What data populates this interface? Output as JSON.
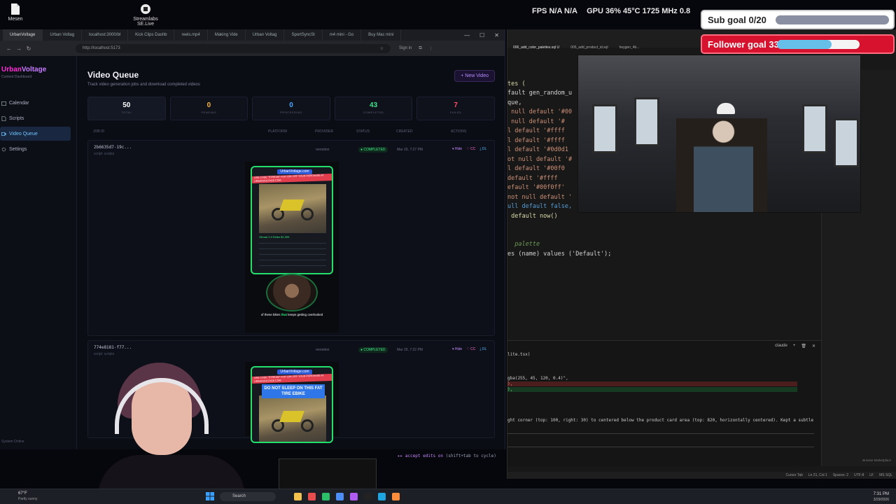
{
  "desktop": {
    "icons": [
      {
        "label": "Mesen",
        "icon": "document-icon"
      },
      {
        "label": "Streamlabs SE.Live",
        "icon": "streamlabs-icon"
      }
    ],
    "hud": {
      "fps": "FPS N/A N/A",
      "gpu": "GPU 36% 45°C 1725 MHz 0.8"
    }
  },
  "browser": {
    "tabs": [
      "UrbanVoltage",
      "Urban Voltag",
      "localhost:3000/bl",
      "Kick Clips Dashb",
      "reels.mp4",
      "Making Vide",
      "Urban Voltag",
      "SportSyncSt",
      "m4 mini - Go",
      "Buy Mac mini"
    ],
    "url": "http://localhost:5173",
    "sign_in": "Sign in"
  },
  "app": {
    "brand_part1": "Urban",
    "brand_part2": "Voltage",
    "brand_sub": "Content Dashboard",
    "nav": [
      {
        "label": "Calendar",
        "icon": "calendar-icon"
      },
      {
        "label": "Scripts",
        "icon": "document-icon"
      },
      {
        "label": "Video Queue",
        "icon": "video-icon"
      },
      {
        "label": "Settings",
        "icon": "gear-icon"
      }
    ],
    "status_text": "System Online",
    "title": "Video Queue",
    "subtitle": "Track video generation jobs and download completed videos",
    "new_button": "New Video",
    "stats": [
      {
        "value": "50",
        "label": "TOTAL",
        "color": "#ffffff"
      },
      {
        "value": "0",
        "label": "PENDING",
        "color": "#f5b544"
      },
      {
        "value": "0",
        "label": "PROCESSING",
        "color": "#4aa8ff"
      },
      {
        "value": "43",
        "label": "COMPLETED",
        "color": "#41e28a"
      },
      {
        "value": "7",
        "label": "FAILED",
        "color": "#ff4d6a"
      }
    ],
    "columns": [
      "JOB ID",
      "PLATFORM",
      "PROVIDER",
      "STATUS",
      "CREATED",
      "ACTIONS"
    ],
    "jobs": [
      {
        "id": "2b6635d7-19c...",
        "script": "script: scripts",
        "provider": "remotion",
        "status": "COMPLETED",
        "created": "Mar 29, 7:27 PM",
        "actions": {
          "hide": "Hide",
          "cc": "CC",
          "dl": "DL"
        },
        "preview": {
          "brand": "UrbanVoltage.com",
          "promo": "USE CODE \"STREAM\" FOR 10% OFF YOUR PURCHASE AT URBANVOLTAGE.COM",
          "spec_title": "Ofroad 2.0 Ebike  $2,399",
          "caption_pre": "of these bikes ",
          "caption_hl": "that",
          "caption_post": " keeps getting overlooked"
        }
      },
      {
        "id": "774e8181-f77...",
        "script": "script: scripts",
        "provider": "remotion",
        "status": "COMPLETED",
        "created": "Mar 29, 7:22 PM",
        "actions": {
          "hide": "Hide",
          "cc": "CC",
          "dl": "DL"
        },
        "preview": {
          "brand": "UrbanVoltage.com",
          "promo": "USE CODE \"STREAM\" FOR 10% OFF YOUR PURCHASE AT URBANVOLTAGE.COM",
          "headline": "DO NOT SLEEP ON THIS FAT TIRE EBIKE"
        }
      }
    ]
  },
  "editor": {
    "tabs": [
      "006_add_color_palettes.sql U",
      "005_add_product_id.sql",
      "heygen_4b..."
    ],
    "code_lines": [
      "tes (",
      "fault gen_random_u",
      "que,",
      " null default '#00",
      " null default '#",
      "l default '#ffff",
      "l default '#ffff",
      "l default '#0d0d1",
      "ot null default '#",
      "l default '#00f0",
      "default '#ffff",
      "efault '#00f0ff'",
      "not null default '",
      "ull default false,",
      " default now()"
    ],
    "comment": "palette",
    "insert_line": "es (name) values ('Default');",
    "terminal": {
      "label": "claude",
      "file": "lite.tsx)",
      "rgba": "gba(255, 45, 120, 0.4)\",",
      "diff1": "),",
      "diff2": "),",
      "message": "ght corner (top: 100, right: 30) to centered below the product card area (top: 820, horizontally centered). Kept a subtle",
      "hint_pre": "▸▸ accept edits on ",
      "hint_post": "(shift+tab to cycle)"
    },
    "right_hint": "Browse Marketplace",
    "status": [
      "Cursor Tab",
      "Ln 21, Col 1",
      "Spaces: 2",
      "UTF-8",
      "LF",
      "MS SQL"
    ]
  },
  "overlays": {
    "sub_goal": {
      "label": "Sub goal 0/20",
      "progress": 0.0
    },
    "follower_goal": {
      "label": "Follower goal 33/50",
      "progress": 0.66
    }
  },
  "taskbar": {
    "weather_temp": "67°F",
    "weather_desc": "Partly sunny",
    "search": "Search",
    "time": "7:31 PM",
    "date": "3/29/2026"
  }
}
